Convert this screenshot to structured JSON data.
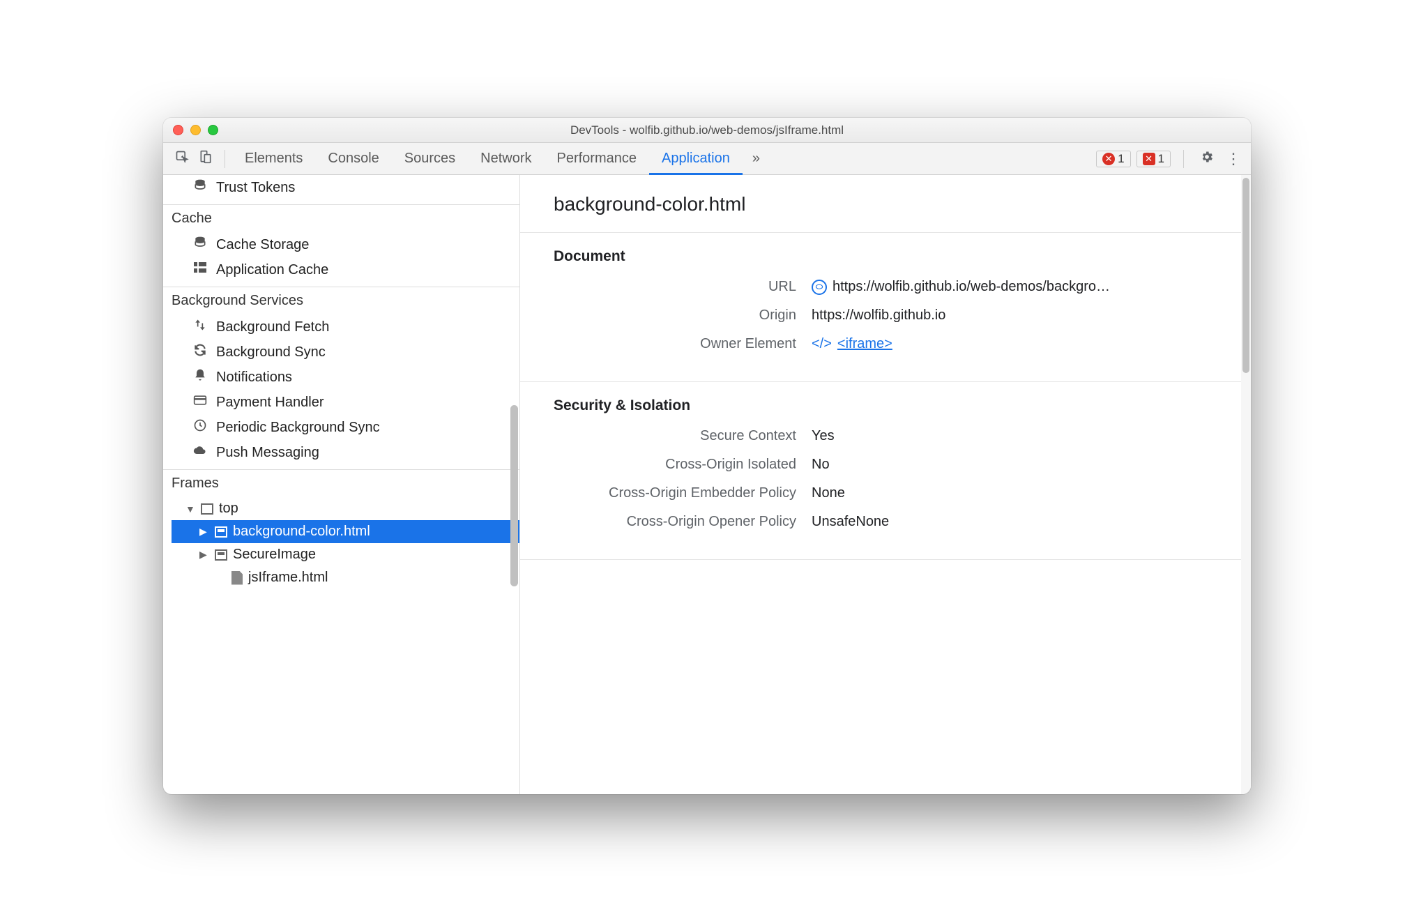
{
  "window": {
    "title": "DevTools - wolfib.github.io/web-demos/jsIframe.html"
  },
  "toolbar": {
    "tabs": [
      "Elements",
      "Console",
      "Sources",
      "Network",
      "Performance",
      "Application"
    ],
    "active_tab_index": 5,
    "more_glyph": "»",
    "error_badge": "1",
    "issue_badge": "1"
  },
  "sidebar": {
    "storage_items": [
      {
        "label": "Trust Tokens",
        "icon": "database"
      }
    ],
    "sections": [
      {
        "title": "Cache",
        "items": [
          {
            "label": "Cache Storage",
            "icon": "database"
          },
          {
            "label": "Application Cache",
            "icon": "grid"
          }
        ]
      },
      {
        "title": "Background Services",
        "items": [
          {
            "label": "Background Fetch",
            "icon": "updown"
          },
          {
            "label": "Background Sync",
            "icon": "sync"
          },
          {
            "label": "Notifications",
            "icon": "bell"
          },
          {
            "label": "Payment Handler",
            "icon": "card"
          },
          {
            "label": "Periodic Background Sync",
            "icon": "clock"
          },
          {
            "label": "Push Messaging",
            "icon": "cloud"
          }
        ]
      }
    ],
    "frames": {
      "title": "Frames",
      "tree": [
        {
          "label": "top",
          "depth": 1,
          "expanded": true,
          "icon": "frame"
        },
        {
          "label": "background-color.html",
          "depth": 2,
          "expanded": false,
          "icon": "iframe",
          "selected": true,
          "arrow": "right"
        },
        {
          "label": "SecureImage",
          "depth": 2,
          "expanded": false,
          "icon": "iframe",
          "arrow": "right"
        },
        {
          "label": "jsIframe.html",
          "depth": 3,
          "icon": "file"
        }
      ]
    }
  },
  "main": {
    "page_title": "background-color.html",
    "sections": [
      {
        "title": "Document",
        "rows": [
          {
            "label": "URL",
            "value": "https://wolfib.github.io/web-demos/backgro…",
            "icon": "pill"
          },
          {
            "label": "Origin",
            "value": "https://wolfib.github.io"
          },
          {
            "label": "Owner Element",
            "value": "<iframe>",
            "link": true,
            "icon": "code"
          }
        ]
      },
      {
        "title": "Security & Isolation",
        "rows": [
          {
            "label": "Secure Context",
            "value": "Yes"
          },
          {
            "label": "Cross-Origin Isolated",
            "value": "No"
          },
          {
            "label": "Cross-Origin Embedder Policy",
            "value": "None"
          },
          {
            "label": "Cross-Origin Opener Policy",
            "value": "UnsafeNone"
          }
        ]
      }
    ]
  }
}
